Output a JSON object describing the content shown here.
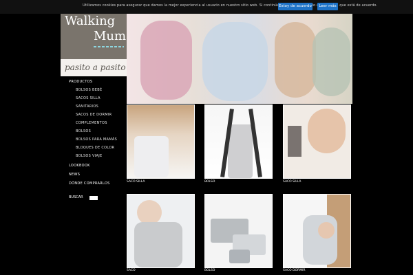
{
  "cookie": {
    "text": "Utilizamos cookies para asegurar que damos la mejor experiencia al usuario en nuestro sitio web. Si continúa utilizando este sitio asumiremos que está de acuerdo.",
    "accept_label": "Estoy de acuerdo",
    "more_label": "Leer más"
  },
  "logo": {
    "line1": "Walking",
    "line2": "Mum",
    "tagline": "pasito a pasito"
  },
  "menu": {
    "items": [
      {
        "label": "PRODUCTOS",
        "level": "top"
      },
      {
        "label": "BOLSOS BEBÉ",
        "level": "sub"
      },
      {
        "label": "SACOS SILLA",
        "level": "sub"
      },
      {
        "label": "SANITARIOS",
        "level": "sub"
      },
      {
        "label": "SACOS DE DORMIR",
        "level": "sub"
      },
      {
        "label": "COMPLEMENTOS",
        "level": "sub"
      },
      {
        "label": "BOLSOS",
        "level": "sub"
      },
      {
        "label": "BOLSOS PARA MAMÁS",
        "level": "sub"
      },
      {
        "label": "BLOQUES DE COLOR",
        "level": "sub"
      },
      {
        "label": "BOLSOS VIAJE",
        "level": "sub"
      },
      {
        "label": "LOOKBOOK",
        "level": "top"
      },
      {
        "label": "NEWS",
        "level": "top"
      },
      {
        "label": "DÓNDE COMPRARLOS",
        "level": "top"
      }
    ],
    "search_label": "BUSCAR"
  },
  "products": [
    {
      "title": "SACO SILLA"
    },
    {
      "title": "BOLSO"
    },
    {
      "title": "SACO SILLA"
    },
    {
      "title": "SACO"
    },
    {
      "title": "BOLSO"
    },
    {
      "title": "SACO DORMIR"
    }
  ]
}
